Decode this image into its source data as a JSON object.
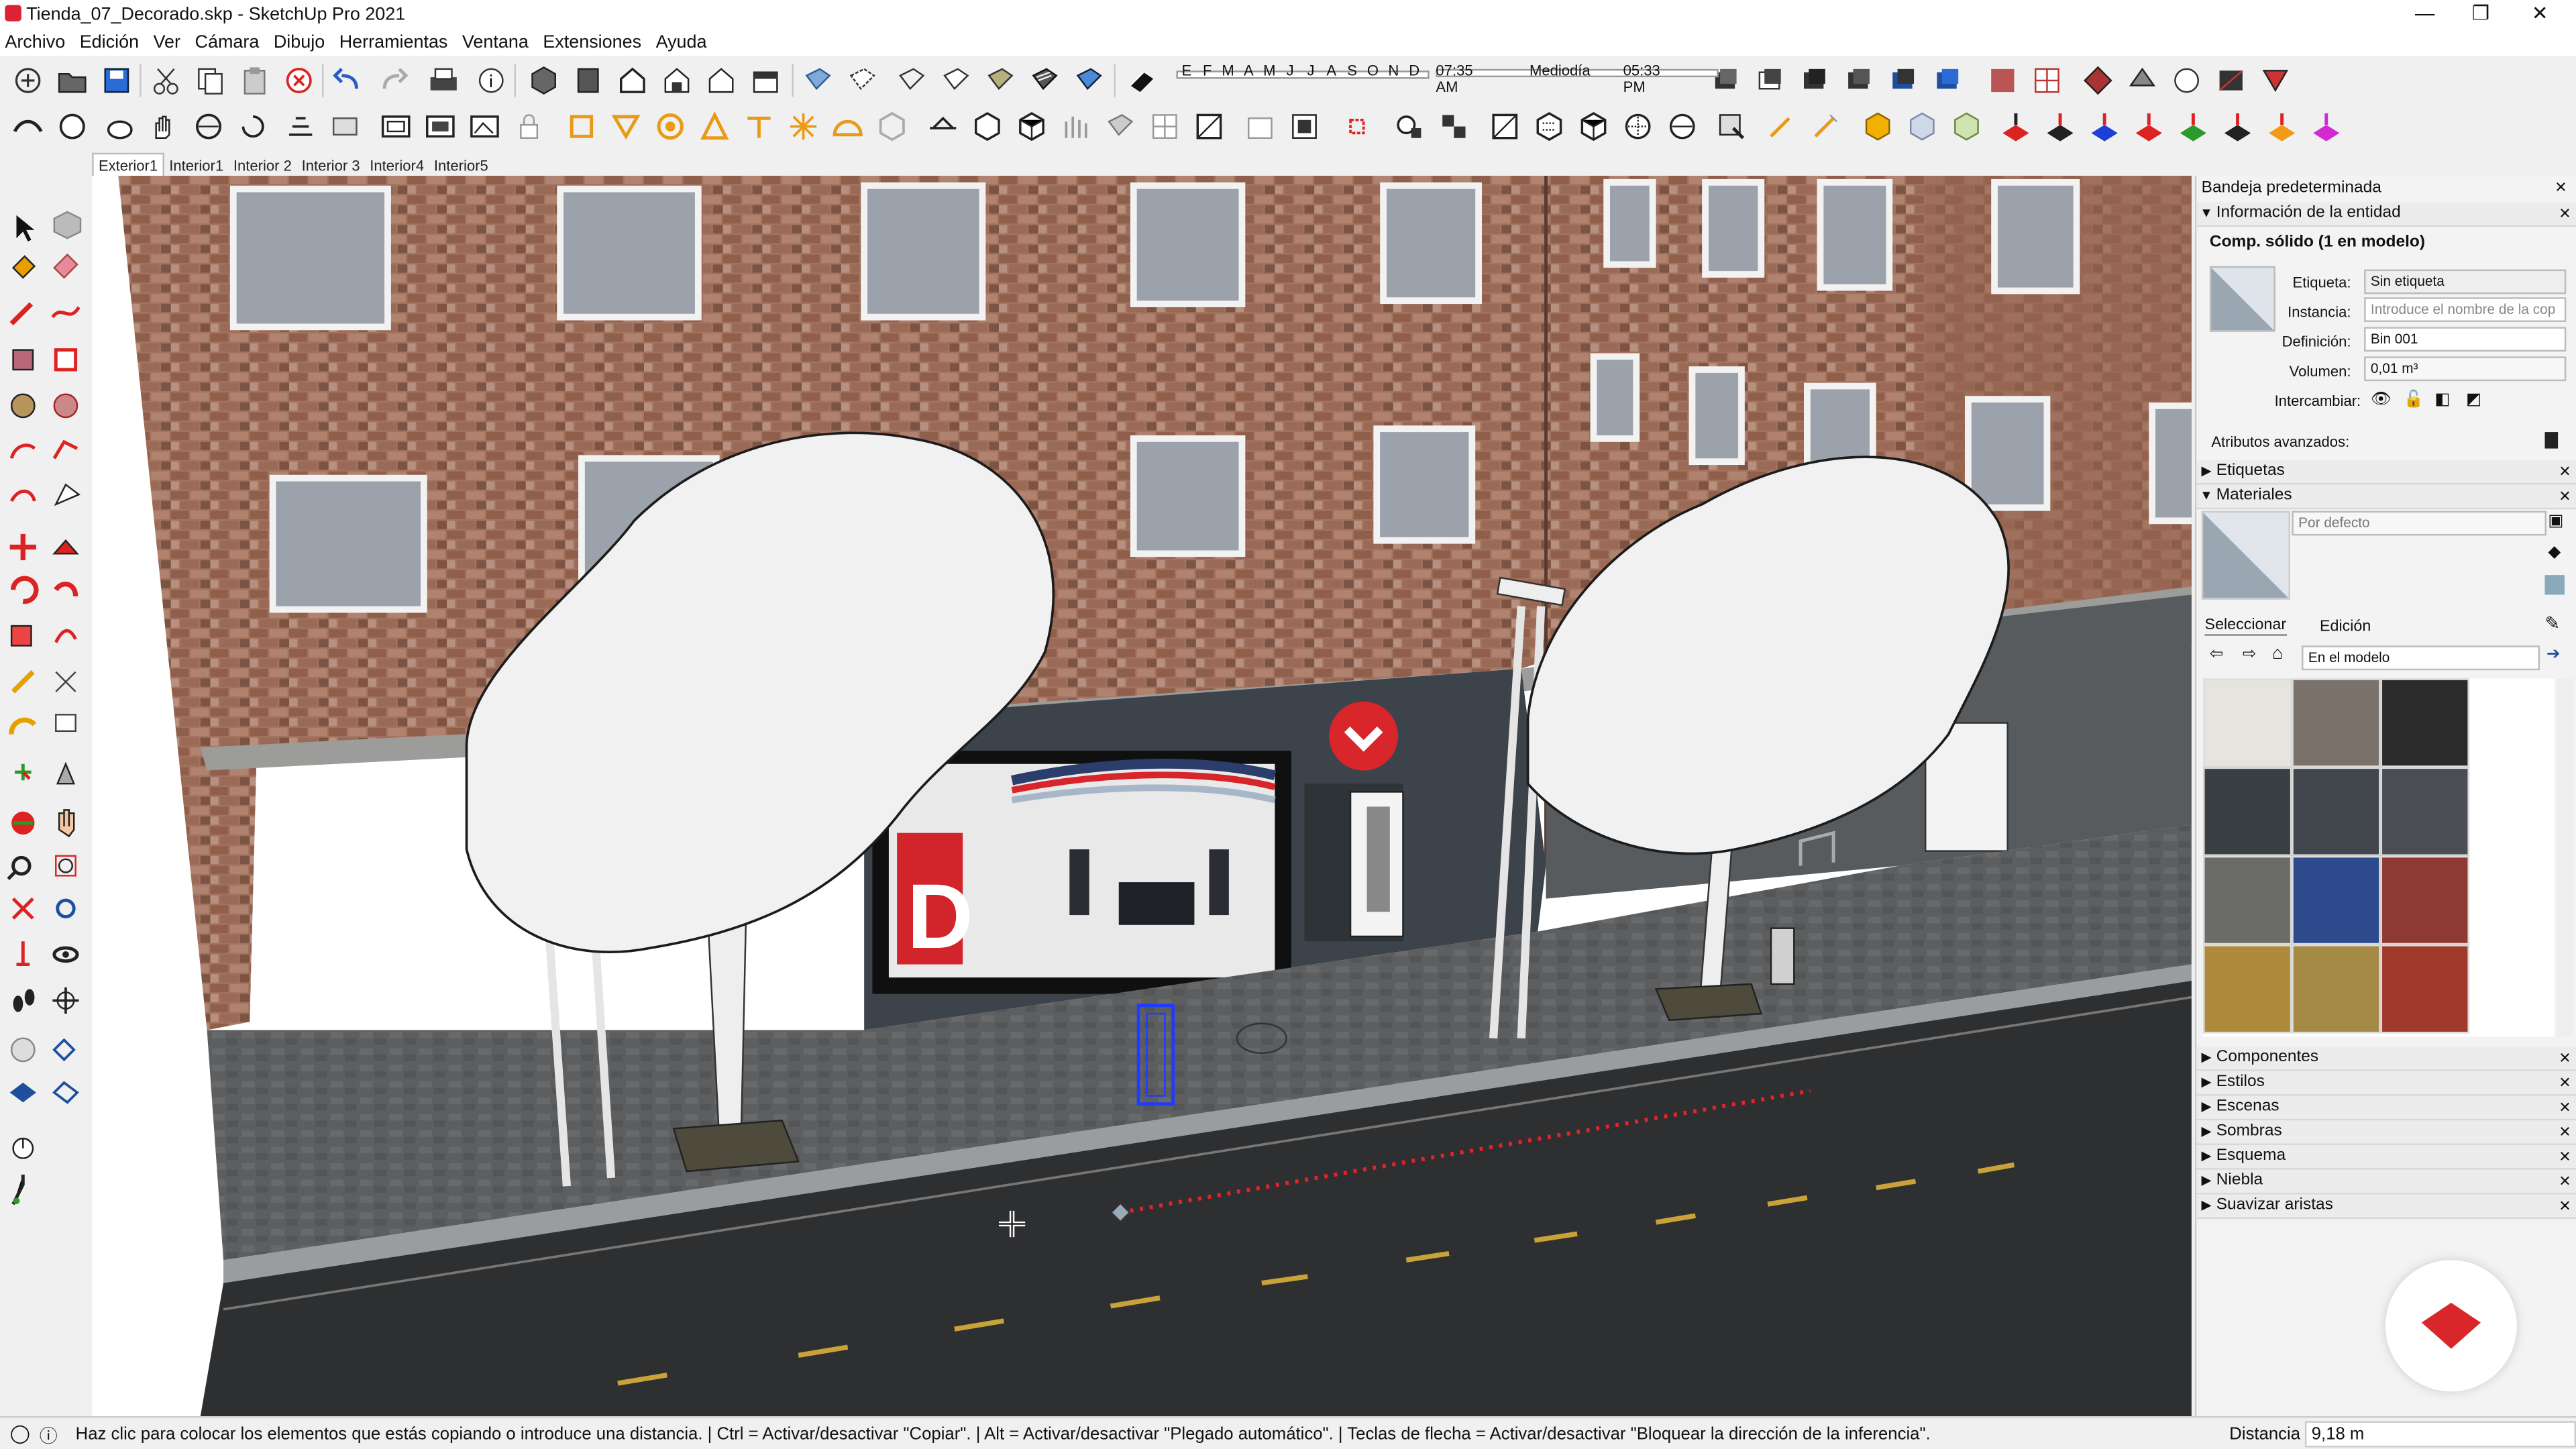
{
  "window": {
    "title": "Tienda_07_Decorado.skp - SketchUp Pro 2021",
    "minimize": "—",
    "restore": "❐",
    "close": "✕"
  },
  "menu": [
    "Archivo",
    "Edición",
    "Ver",
    "Cámara",
    "Dibujo",
    "Herramientas",
    "Ventana",
    "Extensiones",
    "Ayuda"
  ],
  "sun": {
    "months": [
      "E",
      "F",
      "M",
      "A",
      "M",
      "J",
      "J",
      "A",
      "S",
      "O",
      "N",
      "D"
    ],
    "time_start": "07:35 AM",
    "time_mid": "Mediodía",
    "time_end": "05:33 PM"
  },
  "scene_tabs": [
    "Exterior1",
    "Interior1",
    "Interior 2",
    "Interior 3",
    "Interior4",
    "Interior5"
  ],
  "tray": {
    "title": "Bandeja predeterminada",
    "entity_info": {
      "header": "Información de la entidad",
      "entity_title": "Comp. sólido (1 en modelo)",
      "label_etiqueta": "Etiqueta:",
      "value_etiqueta": "Sin etiqueta",
      "label_instancia": "Instancia:",
      "placeholder_instancia": "Introduce el nombre de la cop",
      "label_definicion": "Definición:",
      "value_definicion": "Bin 001",
      "label_volumen": "Volumen:",
      "value_volumen": "0,01 m³",
      "label_intercambiar": "Intercambiar:",
      "advanced": "Atributos avanzados:"
    },
    "etiquetas_header": "Etiquetas",
    "materials": {
      "header": "Materiales",
      "current": "Por defecto",
      "tab_select": "Seleccionar",
      "tab_edit": "Edición",
      "collection": "En el modelo",
      "swatch_colors": [
        "#e6e4df",
        "#7a716b",
        "#2b2b2b",
        "#3a3f44",
        "#40464c",
        "#4a4d53",
        "#6b6b68",
        "#2c4a8c",
        "#8c3a32",
        "#b08a3c",
        "#a48a45",
        "#a03a2c"
      ]
    },
    "collapsed_panels": [
      "Componentes",
      "Estilos",
      "Escenas",
      "Sombras",
      "Esquema",
      "Niebla",
      "Suavizar aristas"
    ]
  },
  "status": {
    "message": "Haz clic para colocar los elementos que estás copiando o introduce una distancia. | Ctrl = Activar/desactivar \"Copiar\". | Alt = Activar/desactivar \"Plegado automático\". | Teclas de flecha = Activar/desactivar \"Bloquear la dirección de la inferencia\".",
    "distance_label": "Distancia",
    "distance_value": "9,18 m"
  },
  "store_sign": "D",
  "colors": {
    "brick": "#9a6a55",
    "accent": "#d8262b",
    "selection": "#1f3bff",
    "inference": "#e0242a"
  }
}
